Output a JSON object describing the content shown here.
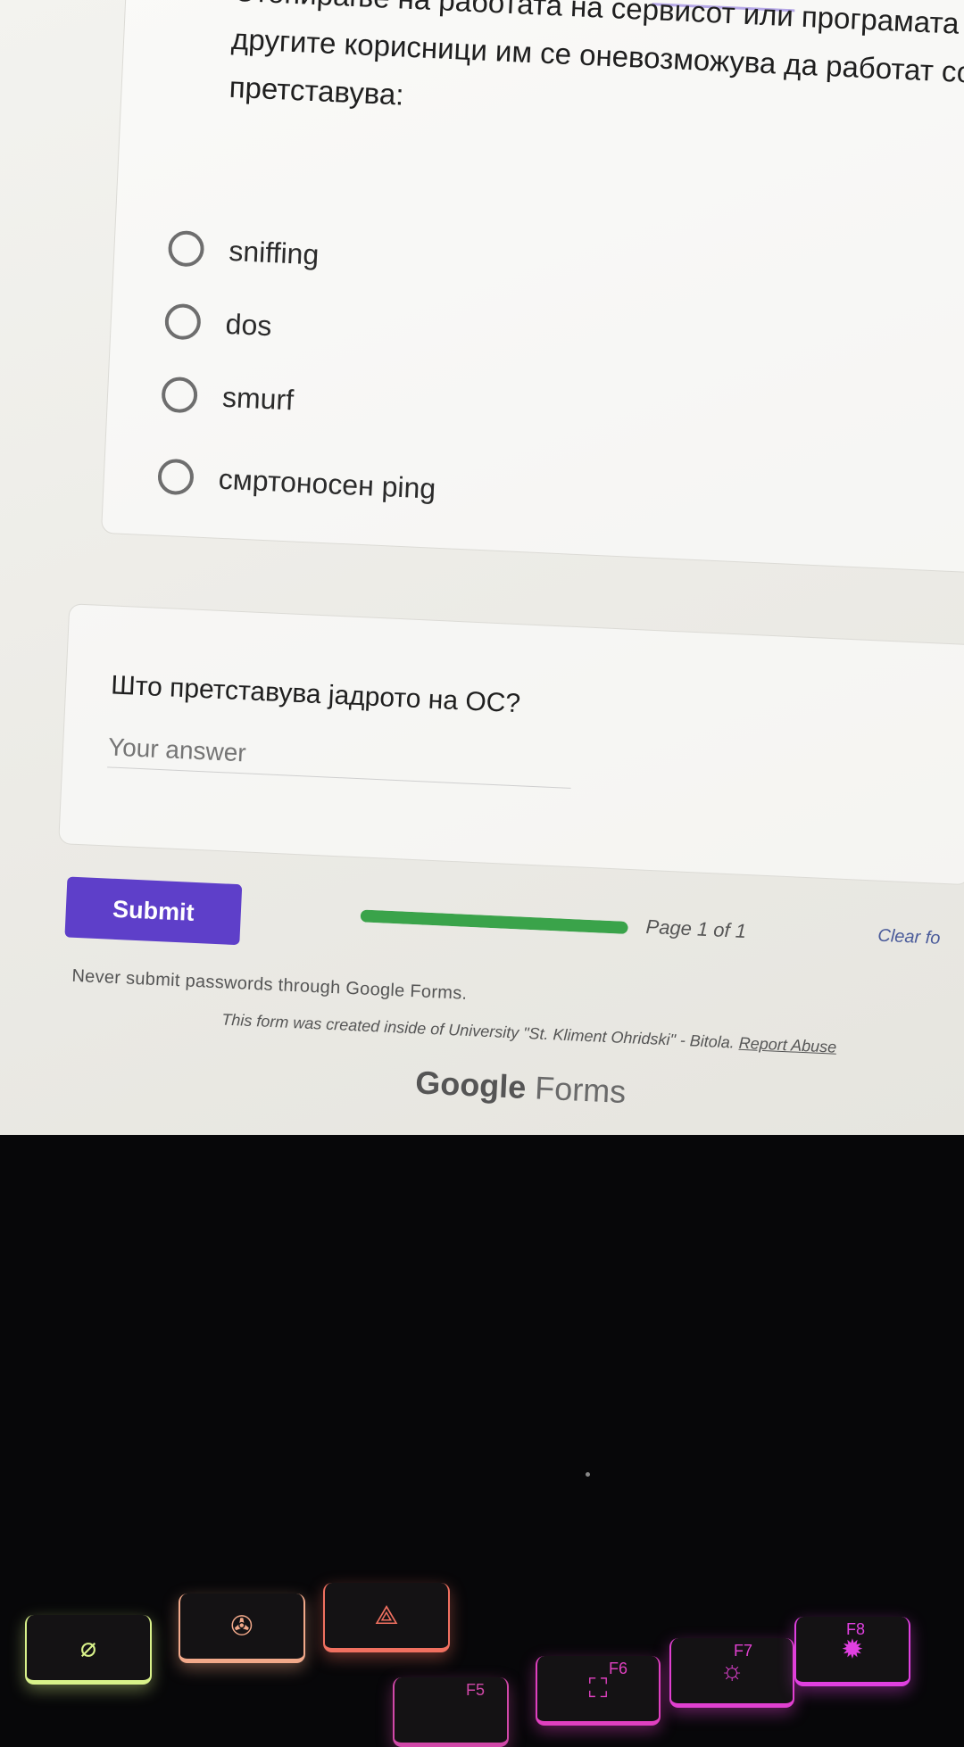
{
  "question1": {
    "text_lines": [
      "Стопирање на работата на сервисот или програмата т",
      "другите корисници им се оневозможува да работат со",
      "претставува:"
    ],
    "options": [
      "sniffing",
      "dos",
      "smurf",
      "смртоносен ping"
    ]
  },
  "question2": {
    "text": "Што претставува јадрото на ОС?",
    "answer_placeholder": "Your answer"
  },
  "footer": {
    "submit_label": "Submit",
    "progress": 1.0,
    "page_indicator": "Page 1 of 1",
    "clear_form_label": "Clear fo",
    "password_warning": "Never submit passwords through Google Forms.",
    "created_note": "This form was created inside of University \"St. Kliment Ohridski\" - Bitola.",
    "report_abuse_label": "Report Abuse",
    "logo_google": "Google",
    "logo_forms": "Forms"
  },
  "keyboard": {
    "keys": [
      {
        "label": "",
        "icon": "mic-mute-icon",
        "glow": "#d9f28a"
      },
      {
        "label": "",
        "icon": "fan-icon",
        "glow": "#f2a98a"
      },
      {
        "label": "",
        "icon": "rog-logo-icon",
        "glow": "#f07060"
      },
      {
        "label": "F5",
        "icon": "",
        "glow": "#d048a8"
      },
      {
        "label": "F6",
        "icon": "screenshot-icon",
        "glow": "#e040c0"
      },
      {
        "label": "F7",
        "icon": "brightness-down-icon",
        "glow": "#e040d0"
      },
      {
        "label": "F8",
        "icon": "brightness-up-icon",
        "glow": "#e040e0"
      }
    ]
  }
}
